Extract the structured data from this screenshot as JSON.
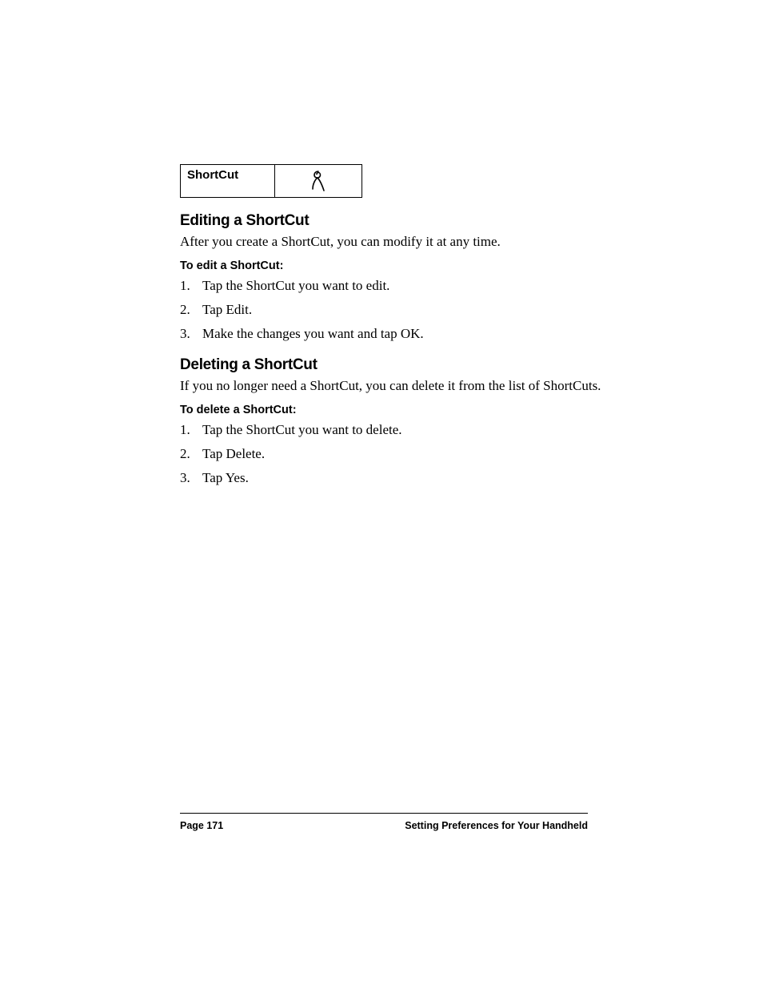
{
  "fig": {
    "label": "ShortCut"
  },
  "sec1": {
    "heading": "Editing a ShortCut",
    "intro": "After you create a ShortCut, you can modify it at any time.",
    "proc_heading": "To edit a ShortCut:",
    "steps": [
      "Tap the ShortCut you want to edit.",
      "Tap Edit.",
      "Make the changes you want and tap OK."
    ]
  },
  "sec2": {
    "heading": "Deleting a ShortCut",
    "intro": "If you no longer need a ShortCut, you can delete it from the list of ShortCuts.",
    "proc_heading": "To delete a ShortCut:",
    "steps": [
      "Tap the ShortCut you want to delete.",
      "Tap Delete.",
      "Tap Yes."
    ]
  },
  "footer": {
    "page": "Page 171",
    "title": "Setting Preferences for Your Handheld"
  }
}
